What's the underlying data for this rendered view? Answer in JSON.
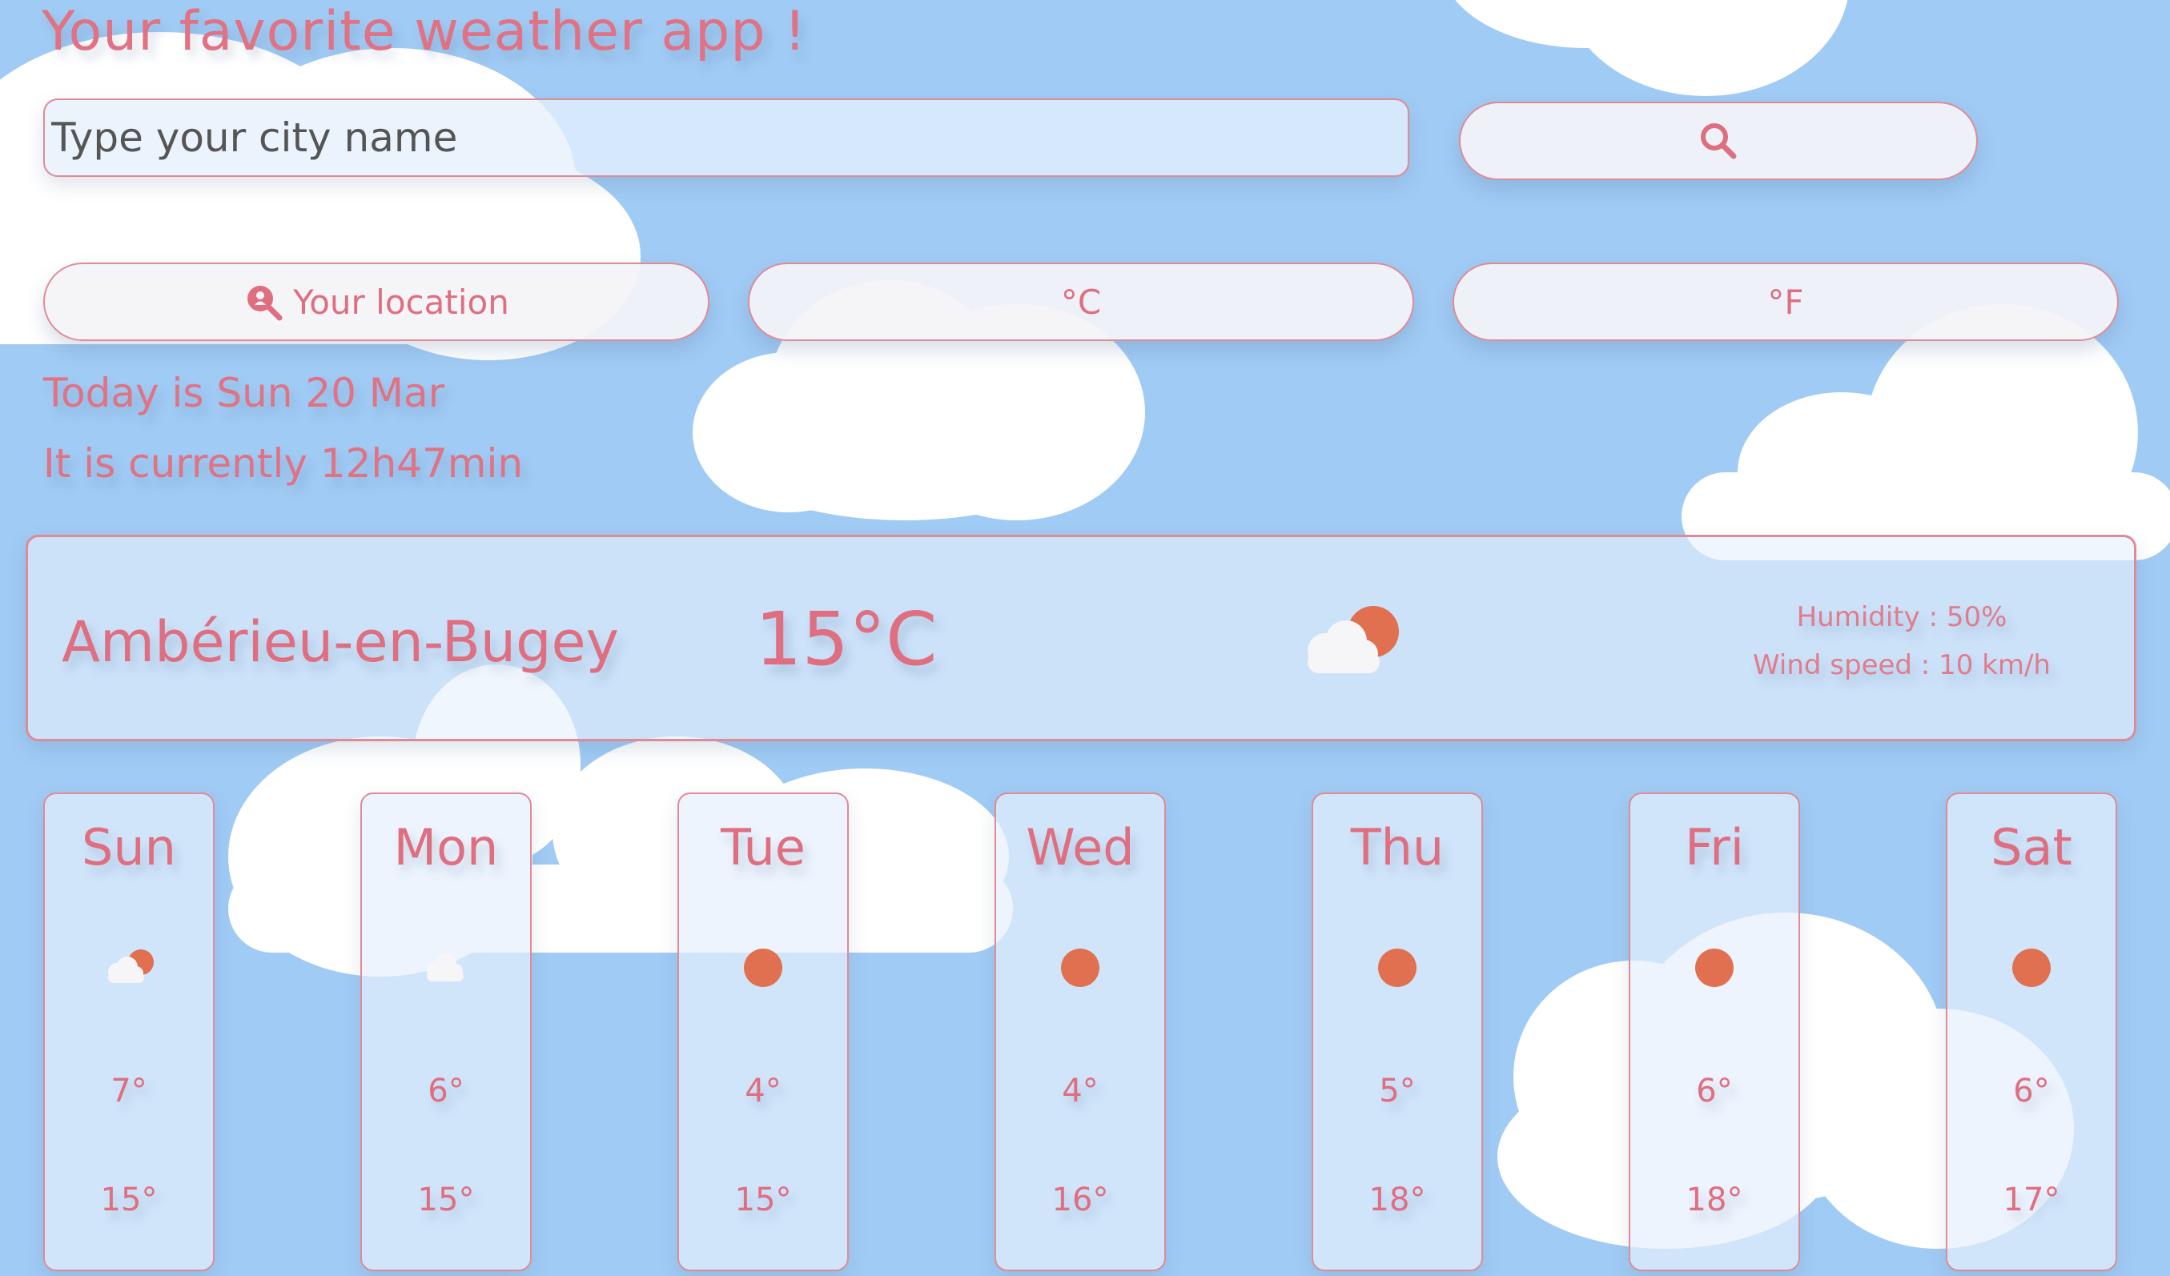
{
  "header": {
    "title": "Your favorite weather app !"
  },
  "search": {
    "placeholder": "Type your city name",
    "button_icon": "search-icon"
  },
  "controls": {
    "location_label": "Your location",
    "location_icon": "location-search-icon",
    "celsius_label": "°C",
    "fahrenheit_label": "°F"
  },
  "today": {
    "date_text": "Today is Sun 20 Mar",
    "time_text": "It is currently 12h47min"
  },
  "current": {
    "city": "Ambérieu-en-Bugey",
    "temperature": "15°C",
    "icon": "partly-cloudy-icon",
    "humidity": "Humidity : 50%",
    "wind": "Wind speed : 10 km/h"
  },
  "forecast": [
    {
      "day": "Sun",
      "icon": "partly-cloudy-icon",
      "min": "7°",
      "max": "15°"
    },
    {
      "day": "Mon",
      "icon": "cloud-icon",
      "min": "6°",
      "max": "15°"
    },
    {
      "day": "Tue",
      "icon": "sun-icon",
      "min": "4°",
      "max": "15°"
    },
    {
      "day": "Wed",
      "icon": "sun-icon",
      "min": "4°",
      "max": "16°"
    },
    {
      "day": "Thu",
      "icon": "sun-icon",
      "min": "5°",
      "max": "18°"
    },
    {
      "day": "Fri",
      "icon": "sun-icon",
      "min": "6°",
      "max": "18°"
    },
    {
      "day": "Sat",
      "icon": "sun-icon",
      "min": "6°",
      "max": "17°"
    }
  ],
  "colors": {
    "background": "#a0cbf4",
    "accent": "#df6e80",
    "sun": "#e07050",
    "cloud": "#ffffff"
  }
}
